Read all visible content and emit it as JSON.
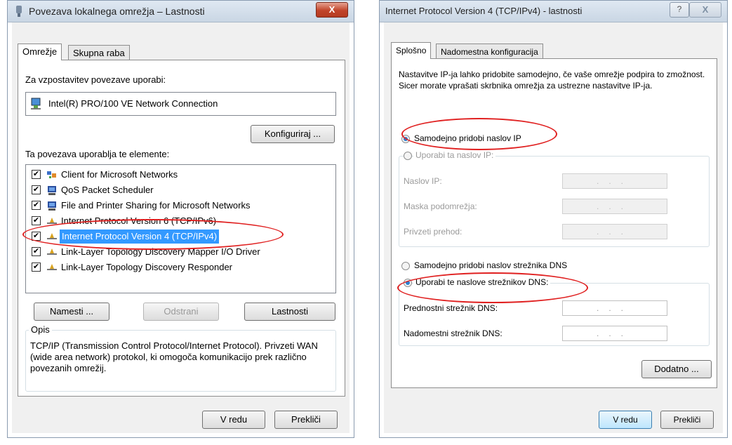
{
  "left_dialog": {
    "title": "Povezava lokalnega omrežja – Lastnosti",
    "close_label": "X",
    "tabs": [
      {
        "label": "Omrežje"
      },
      {
        "label": "Skupna raba"
      }
    ],
    "connect_using_label": "Za vzpostavitev povezave uporabi:",
    "adapter_name": "Intel(R) PRO/100 VE Network Connection",
    "configure_button": "Konfiguriraj ...",
    "items_label": "Ta povezava uporablja te elemente:",
    "items": [
      {
        "label": "Client for Microsoft Networks",
        "checked": true
      },
      {
        "label": "QoS Packet Scheduler",
        "checked": true
      },
      {
        "label": "File and Printer Sharing for Microsoft Networks",
        "checked": true
      },
      {
        "label": "Internet Protocol Version 6 (TCP/IPv6)",
        "checked": true
      },
      {
        "label": "Internet Protocol Version 4 (TCP/IPv4)",
        "checked": true,
        "selected": true
      },
      {
        "label": "Link-Layer Topology Discovery Mapper I/O Driver",
        "checked": true
      },
      {
        "label": "Link-Layer Topology Discovery Responder",
        "checked": true
      }
    ],
    "install_button": "Namesti ...",
    "uninstall_button": "Odstrani",
    "properties_button": "Lastnosti",
    "description_title": "Opis",
    "description_text": "TCP/IP (Transmission Control Protocol/Internet Protocol). Privzeti WAN (wide area network) protokol, ki omogoča komunikacijo prek različno povezanih omrežij.",
    "ok_button": "V redu",
    "cancel_button": "Prekliči",
    "check_mark": "✔"
  },
  "right_dialog": {
    "title": "Internet Protocol Version 4 (TCP/IPv4) - lastnosti",
    "help_label": "?",
    "close_label": "X",
    "tabs": [
      {
        "label": "Splošno"
      },
      {
        "label": "Nadomestna konfiguracija"
      }
    ],
    "intro_text": "Nastavitve IP-ja lahko pridobite samodejno, če vaše omrežje podpira to zmožnost. Sicer morate vprašati skrbnika omrežja za ustrezne nastavitve IP-ja.",
    "auto_ip_label": "Samodejno pridobi naslov IP",
    "auto_ip_selected": true,
    "use_ip_label": "Uporabi ta naslov IP:",
    "ip_address_label": "Naslov IP:",
    "subnet_label": "Maska podomrežja:",
    "gateway_label": "Privzeti prehod:",
    "ip_placeholder": "...",
    "auto_dns_label": "Samodejno pridobi naslov strežnika DNS",
    "use_dns_label": "Uporabi te naslove strežnikov DNS:",
    "use_dns_selected": true,
    "preferred_dns_label": "Prednostni strežnik DNS:",
    "alternate_dns_label": "Nadomestni strežnik DNS:",
    "advanced_button": "Dodatno ...",
    "ok_button": "V redu",
    "cancel_button": "Prekliči"
  },
  "colors": {
    "highlight_oval": "#e02020",
    "selection": "#3399ff"
  }
}
